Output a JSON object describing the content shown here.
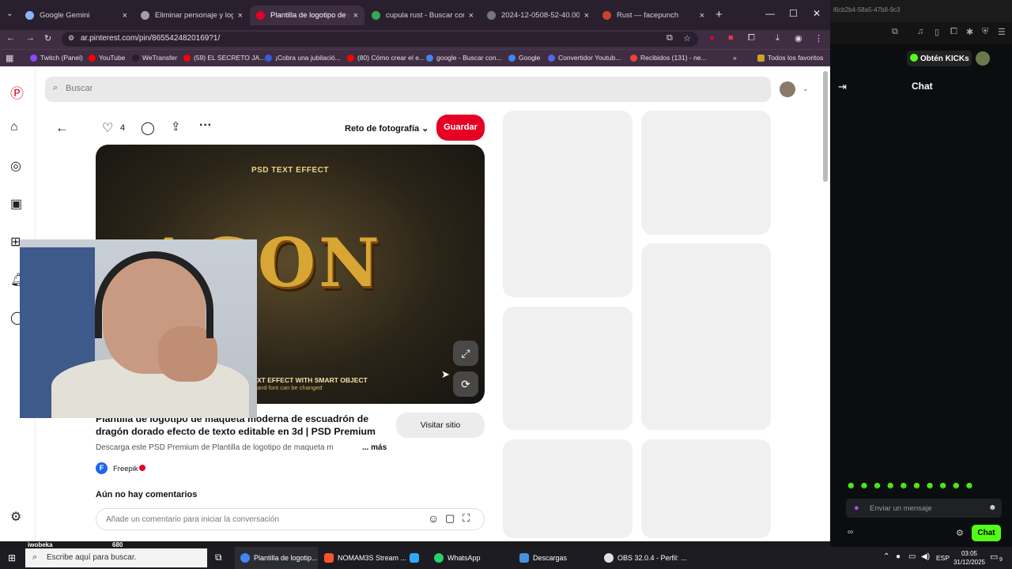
{
  "tabs": [
    {
      "label": "Google Gemini",
      "color": "#8ab4f8",
      "active": false
    },
    {
      "label": "Eliminar personaje y logo",
      "color": "#a0a0a0",
      "active": false
    },
    {
      "label": "Plantilla de logotipo de ma",
      "color": "#e60023",
      "active": true
    },
    {
      "label": "cupula rust - Buscar con Go",
      "color": "#34a853",
      "active": false
    },
    {
      "label": "2024-12-0508-52-40.00_02",
      "color": "#777777",
      "active": false
    },
    {
      "label": "Rust — facepunch",
      "color": "#cd412b",
      "active": false
    }
  ],
  "url": "ar.pinterest.com/pin/8655424820169?1/",
  "bookmarks": [
    {
      "label": "Twitch (Panel)",
      "color": "#9146ff"
    },
    {
      "label": "YouTube",
      "color": "#ff0000"
    },
    {
      "label": "WeTransfer",
      "color": "#222222"
    },
    {
      "label": "(59) EL SECRETO JA...",
      "color": "#ff0000"
    },
    {
      "label": "¡Cobra una jubilació...",
      "color": "#3b5bdb"
    },
    {
      "label": "(80) Cómo crear el e...",
      "color": "#ff0000"
    },
    {
      "label": "google - Buscar con...",
      "color": "#4285f4"
    },
    {
      "label": "Google",
      "color": "#4285f4"
    },
    {
      "label": "Convertidor Youtub...",
      "color": "#5566ee"
    },
    {
      "label": "Recibidos (131) - ne...",
      "color": "#ea4335"
    },
    {
      "label": "Todos los favoritos",
      "color": "#c9a227"
    }
  ],
  "search": {
    "placeholder": "Buscar"
  },
  "pin": {
    "likes": "4",
    "board": "Reto de fotografía",
    "save_label": "Guardar",
    "image_text_top": "PSD TEXT EFFECT",
    "image_text_big": "AGON",
    "image_text_bottom": "XT EFFECT WITH SMART OBJECT",
    "image_text_bottom2": "and font can be changed",
    "title": "Plantilla de logotipo de maqueta moderna de escuadrón de dragón dorado efecto de texto editable en 3d | PSD Premium",
    "visit_label": "Visitar sitio",
    "description": "Descarga este PSD Premium de Plantilla de logotipo de maqueta m",
    "more_label": "... más",
    "author": "Freepik",
    "no_comments": "Aún no hay comentarios",
    "comment_placeholder": "Añade un comentario para iniciar la conversación"
  },
  "taskbar": {
    "search": "Escribe aquí para buscar.",
    "apps": [
      {
        "label": "Plantilla de logotip...",
        "color": "#4285f4"
      },
      {
        "label": "NOMAM3S Stream ...",
        "color": "#fb542b"
      },
      {
        "label": "Lr",
        "color": "#31a8ff"
      },
      {
        "label": "WhatsApp",
        "color": "#25d366"
      },
      {
        "label": "Descargas",
        "color": "#4a90e2"
      },
      {
        "label": "OBS 32.0.4 - Perfil: ...",
        "color": "#e0e0e0"
      }
    ],
    "lang": "ESP",
    "time": "03:05",
    "date": "31/12/2025",
    "notif": "9"
  },
  "overlay": {
    "name": "iwobeka",
    "count": "680"
  },
  "kick": {
    "url_fragment": "l6cb2b4-58a5-47b8-9c3",
    "obtain_label": "Obtén KICKs",
    "chat_title": "Chat",
    "message_placeholder": "Enviar un mensaje",
    "chat_button": "Chat",
    "accent": "#53fc18"
  },
  "colors": {
    "pinterest_red": "#e60023"
  }
}
